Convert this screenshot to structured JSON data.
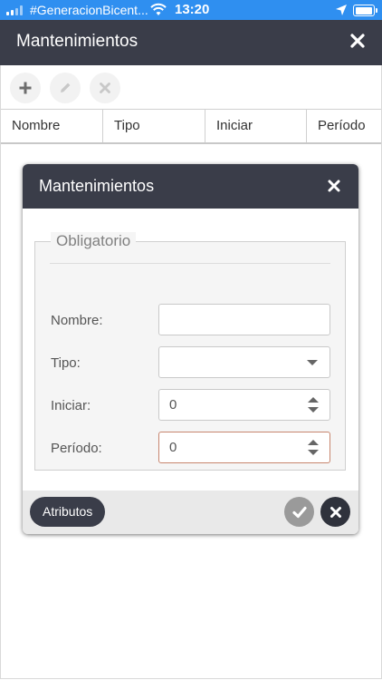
{
  "status_bar": {
    "carrier": "#GeneracionBicent...",
    "time": "13:20",
    "battery_level": 1.0
  },
  "header": {
    "title": "Mantenimientos",
    "close_icon": "close-icon"
  },
  "toolbar": {
    "add_icon": "plus-icon",
    "edit_icon": "pencil-icon",
    "delete_icon": "x-icon"
  },
  "table": {
    "columns": [
      "Nombre",
      "Tipo",
      "Iniciar",
      "Período"
    ]
  },
  "dialog": {
    "title": "Mantenimientos",
    "fieldset_legend": "Obligatorio",
    "fields": {
      "nombre": {
        "label": "Nombre:",
        "value": ""
      },
      "tipo": {
        "label": "Tipo:",
        "value": ""
      },
      "iniciar": {
        "label": "Iniciar:",
        "value": "0"
      },
      "periodo": {
        "label": "Período:",
        "value": "0"
      }
    },
    "attributes_label": "Atributos",
    "ok_icon": "check-icon",
    "cancel_icon": "close-icon"
  },
  "colors": {
    "status_bar": "#2f8ff0",
    "header": "#3a3d49",
    "error_border": "#c7856e"
  }
}
